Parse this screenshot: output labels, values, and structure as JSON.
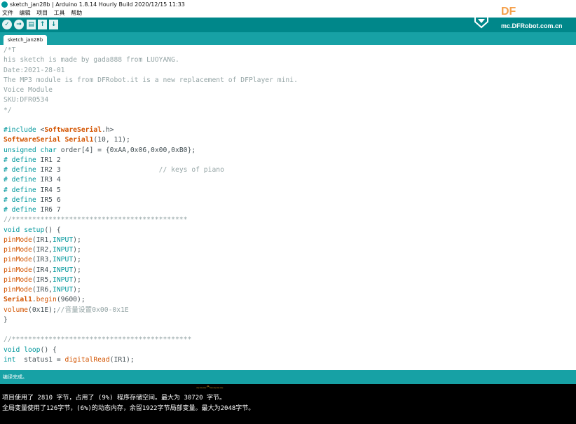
{
  "window": {
    "title": "sketch_jan28b | Arduino 1.8.14 Hourly Build 2020/12/15 11:33"
  },
  "menu": [
    "文件",
    "编辑",
    "项目",
    "工具",
    "帮助"
  ],
  "toolbar": {
    "buttons": [
      {
        "name": "verify",
        "glyph": "✓"
      },
      {
        "name": "upload",
        "glyph": "→"
      },
      {
        "name": "new",
        "glyph": "▤"
      },
      {
        "name": "open",
        "glyph": "↑"
      },
      {
        "name": "save",
        "glyph": "↓"
      }
    ]
  },
  "brand": {
    "logo_text": "DF",
    "url": "mc.DFRobot.com.cn"
  },
  "tab": {
    "label": "sketch_jan28b"
  },
  "editor": {
    "lines": [
      "/*T",
      "his sketch is made by gada888 from LUOYANG.",
      "Date:2021-28-01",
      "The MP3 module is from DFRobot.it is a new replacement of DFPlayer mini.",
      "Voice Module",
      "SKU:DFR0534",
      "*/",
      "",
      "#include <SoftwareSerial.h>",
      "SoftwareSerial Serial1(10, 11);",
      "unsigned char order[4] = {0xAA,0x06,0x00,0xB0};",
      "# define IR1 2",
      "# define IR2 3                        // keys of piano",
      "# define IR3 4",
      "# define IR4 5",
      "# define IR5 6",
      "# define IR6 7",
      "//*******************************************",
      "void setup() {",
      "pinMode(IR1,INPUT);",
      "pinMode(IR2,INPUT);",
      "pinMode(IR3,INPUT);",
      "pinMode(IR4,INPUT);",
      "pinMode(IR5,INPUT);",
      "pinMode(IR6,INPUT);",
      "Serial1.begin(9600);",
      "volume(0x1E);//音量设置0x00-0x1E",
      "}",
      "",
      "//********************************************",
      "void loop() {",
      "int  status1 = digitalRead(IR1);"
    ]
  },
  "status": {
    "text": "编译完成。"
  },
  "console": {
    "line1": "项目使用了 2810 字节，占用了 (9%) 程序存储空间。最大为 30720 字节。",
    "line2": "全局变量使用了126字节，(6%)的动态内存，余留1922字节局部变量。最大为2048字节。"
  },
  "colors": {
    "toolbar": "#00878a",
    "tabstrip": "#17a1a5",
    "comment": "#95a5a6",
    "keyword": "#00979c",
    "function": "#d35400",
    "console_bg": "#000000",
    "brand_orange": "#f5a04a"
  }
}
